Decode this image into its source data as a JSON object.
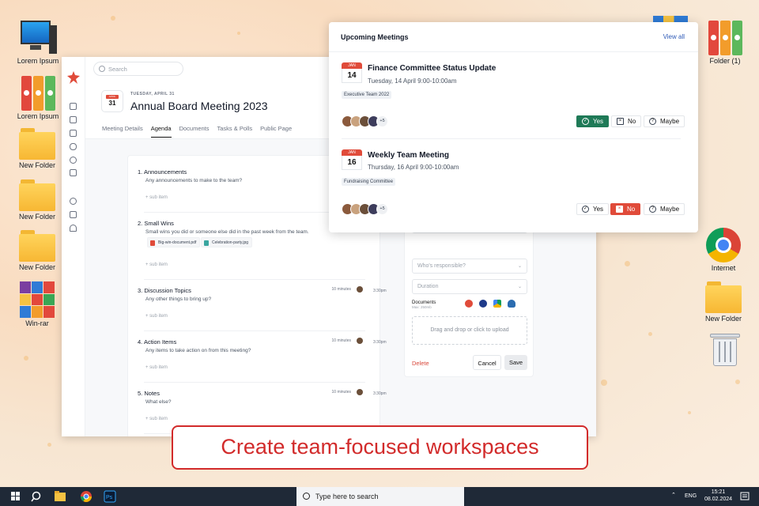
{
  "desktop": {
    "icons": [
      {
        "label": "Lorem Ipsum",
        "icon": "computer-icon"
      },
      {
        "label": "Lorem Ipsum",
        "icon": "binders-icon"
      },
      {
        "label": "New Folder",
        "icon": "folder-icon"
      },
      {
        "label": "New Folder",
        "icon": "folder-icon"
      },
      {
        "label": "New Folder",
        "icon": "folder-icon"
      },
      {
        "label": "Win-rar",
        "icon": "winrar-icon"
      },
      {
        "label": "Folder (1)",
        "icon": "binders-icon"
      },
      {
        "label": "Internet",
        "icon": "chrome-icon"
      },
      {
        "label": "New Folder",
        "icon": "folder-icon"
      }
    ]
  },
  "app": {
    "search_placeholder": "Search",
    "calendar_day": "31",
    "calendar_month": "APRIL",
    "date_label": "TUESDAY, APRIL 31",
    "title": "Annual Board Meeting 2023",
    "tabs": [
      "Meeting Details",
      "Agenda",
      "Documents",
      "Tasks & Polls",
      "Public Page"
    ],
    "agenda": [
      {
        "num": "1.",
        "title": "Announcements",
        "desc": "Any announcements to make to the team?",
        "sub": "+ sub item"
      },
      {
        "num": "2.",
        "title": "Small Wins",
        "desc": "Small wins you did or someone else did in the past week from the team.",
        "sub": "+ sub item",
        "files": [
          "Big-win-document.pdf",
          "Celebration-party.jpg"
        ]
      },
      {
        "num": "3.",
        "title": "Discussion Topics",
        "desc": "Any other things to bring up?",
        "sub": "+ sub item",
        "duration": "10 minutes",
        "time": "3:30pm"
      },
      {
        "num": "4.",
        "title": "Action Items",
        "desc": "Any items to take action on from this meeting?",
        "sub": "+ sub item",
        "duration": "10 minutes",
        "time": "3:30pm"
      },
      {
        "num": "5.",
        "title": "Notes",
        "desc": "What else?",
        "sub": "+ sub item",
        "duration": "10 minutes",
        "time": "3:30pm"
      }
    ],
    "form": {
      "responsible_placeholder": "Who's responsible?",
      "duration_placeholder": "Duration",
      "documents_label": "Documents",
      "documents_max": "Max: 250mb",
      "drop_text": "Drag and drop or click to upload",
      "delete_label": "Delete",
      "cancel_label": "Cancel",
      "save_label": "Save"
    }
  },
  "popup": {
    "title": "Upcoming Meetings",
    "view_all": "View all",
    "meetings": [
      {
        "month": "JAN",
        "day": "14",
        "title": "Finance Committee Status Update",
        "date": "Tuesday, 14 April 9:00-10:00am",
        "tag": "Executive Team 2022",
        "more": "+5",
        "rsvp": "Yes"
      },
      {
        "month": "JAN",
        "day": "16",
        "title": "Weekly Team Meeting",
        "date": "Thursday, 16 April 9:00-10:00am",
        "tag": "Fundraising Committee",
        "more": "+5",
        "rsvp": "No"
      }
    ],
    "rsvp_labels": {
      "yes": "Yes",
      "no": "No",
      "maybe": "Maybe"
    },
    "colors": {
      "yes_selected": "#1f7a57",
      "no_selected": "#e04b3a"
    }
  },
  "banner": {
    "text": "Create team-focused workspaces"
  },
  "taskbar": {
    "search_placeholder": "Type here to search",
    "lang": "ENG",
    "time": "15:21",
    "date": "08.02.2024"
  }
}
